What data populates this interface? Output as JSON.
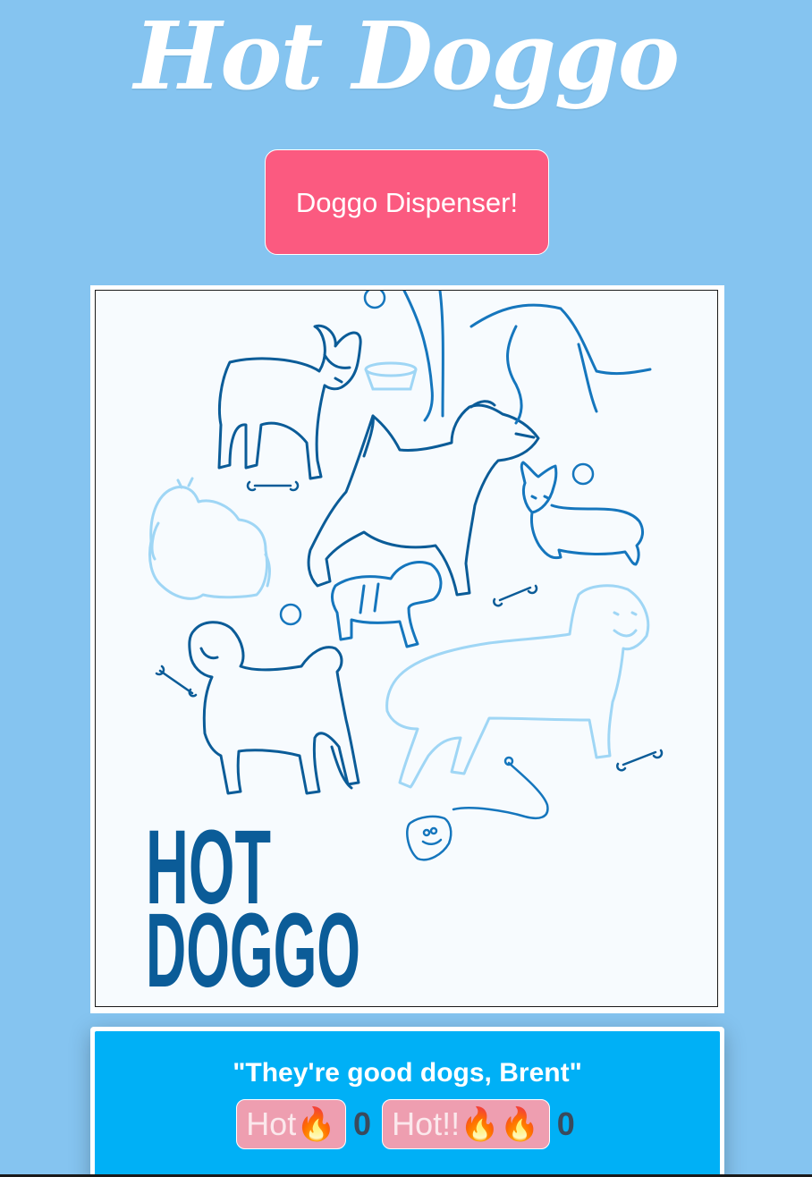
{
  "header": {
    "title": "Hot Doggo"
  },
  "dispenser": {
    "label": "Doggo Dispenser!"
  },
  "image": {
    "logo_line1": "HOT",
    "logo_line2": "DOGGO",
    "colors": {
      "dark_blue": "#0b5c98",
      "mid_blue": "#1576bd",
      "light_blue": "#9fd6f5"
    }
  },
  "card": {
    "quote": "\"They're good dogs, Brent\"",
    "votes": [
      {
        "label": "Hot🔥",
        "count": "0"
      },
      {
        "label": "Hot!!🔥🔥",
        "count": "0"
      }
    ]
  },
  "colors": {
    "background": "#85c4f0",
    "button": "#fb5a80",
    "card": "#00b0f6",
    "vote_button": "#ee9eb0"
  }
}
